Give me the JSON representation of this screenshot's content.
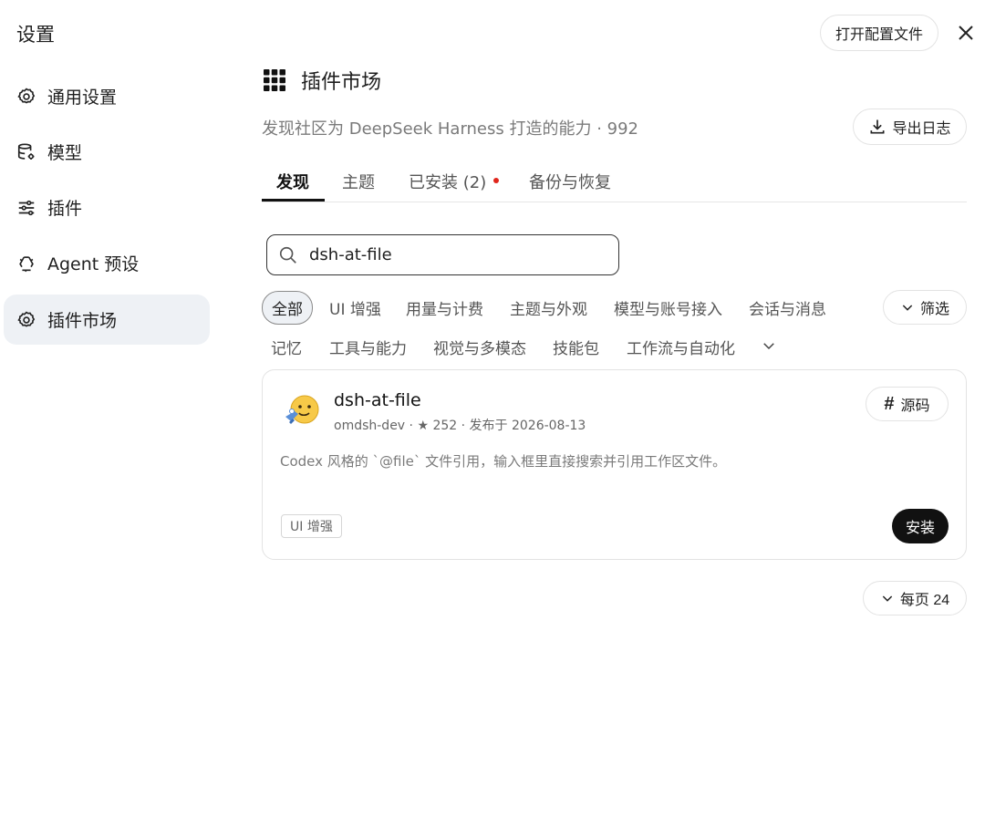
{
  "sidebar": {
    "title": "设置",
    "items": [
      {
        "label": "通用设置",
        "icon": "gear-icon"
      },
      {
        "label": "模型",
        "icon": "database-gear-icon"
      },
      {
        "label": "插件",
        "icon": "sliders-icon"
      },
      {
        "label": "Agent 预设",
        "icon": "recycle-icon"
      },
      {
        "label": "插件市场",
        "icon": "gear-icon",
        "active": true
      }
    ]
  },
  "topbar": {
    "open_config_label": "打开配置文件",
    "close_icon": "close-icon"
  },
  "main": {
    "title": "插件市场",
    "title_icon": "grid-icon",
    "subtitle": "发现社区为 DeepSeek Harness 打造的能力 · 992",
    "export_log_label": "导出日志",
    "tabs": [
      {
        "label": "发现",
        "active": true
      },
      {
        "label": "主题"
      },
      {
        "label": "已安装 (2)",
        "dot": true
      },
      {
        "label": "备份与恢复"
      }
    ],
    "search": {
      "value": "dsh-at-file",
      "placeholder": ""
    },
    "categories_row1": [
      "全部",
      "UI 增强",
      "用量与计费",
      "主题与外观",
      "模型与账号接入",
      "会话与消息"
    ],
    "categories_row2": [
      "记忆",
      "工具与能力",
      "视觉与多模态",
      "技能包",
      "工作流与自动化"
    ],
    "active_category": "全部",
    "filter_label": "筛选",
    "plugin": {
      "name": "dsh-at-file",
      "meta": "omdsh-dev · ★ 252 · 发布于 2026-08-13",
      "description": "Codex 风格的 `@file` 文件引用，输入框里直接搜索并引用工作区文件。",
      "source_label": "源码",
      "tag": "UI 增强",
      "install_label": "安装"
    },
    "per_page_label": "每页 24"
  },
  "colors": {
    "accent": "#111111",
    "active_bg": "#eef1f5",
    "red_dot": "#e0251b",
    "muted_text": "#7a7a7a"
  }
}
